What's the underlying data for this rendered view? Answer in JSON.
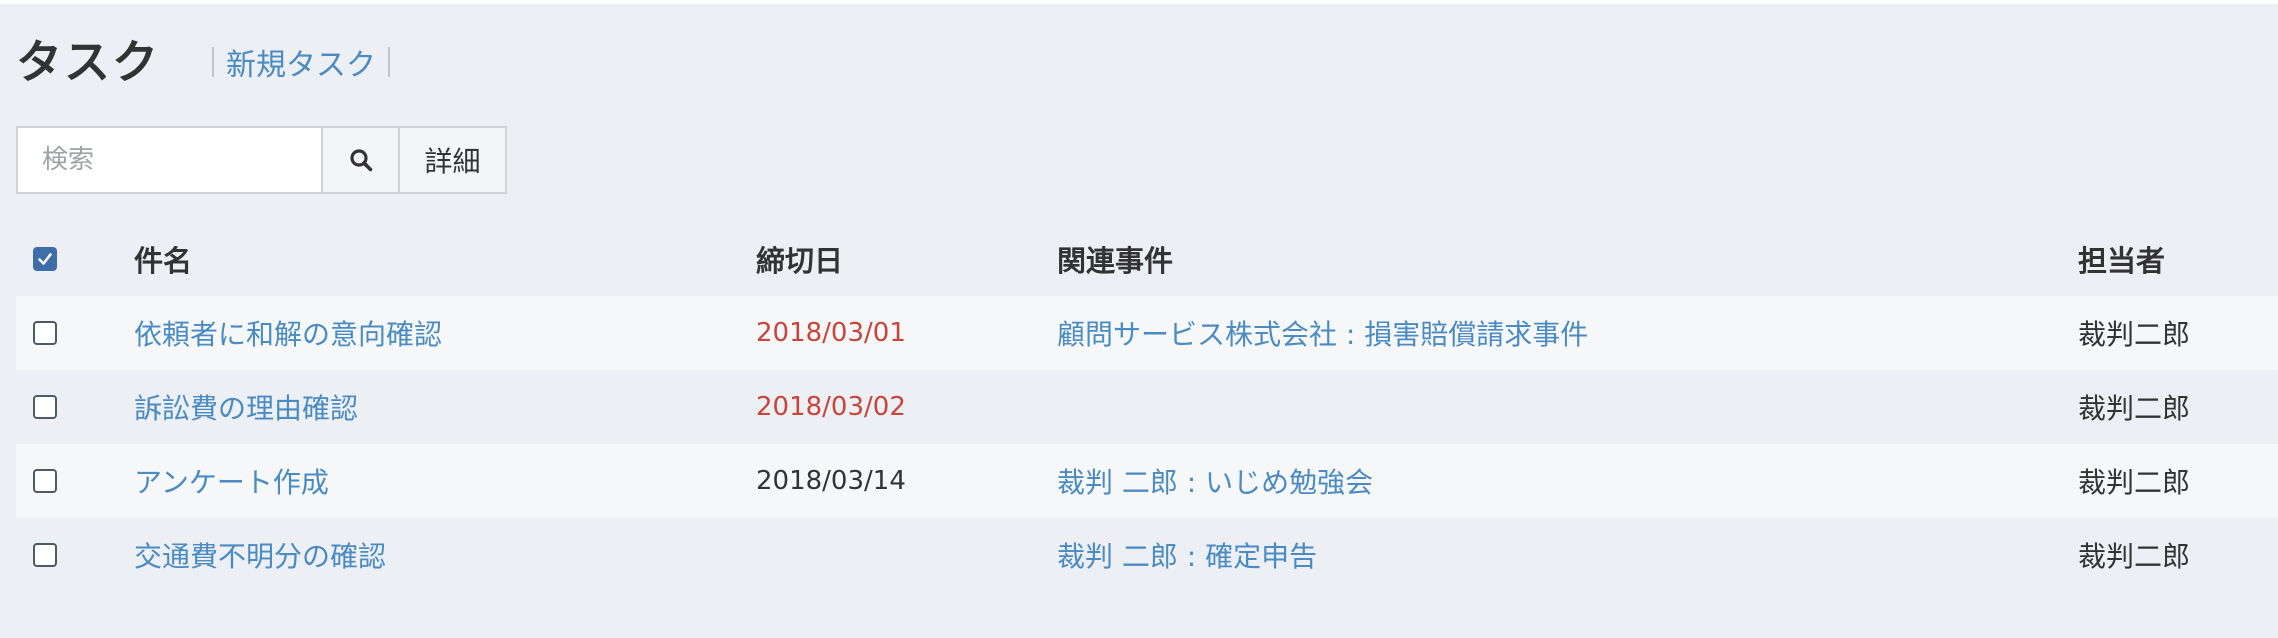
{
  "header": {
    "title": "タスク",
    "new_task_link": "新規タスク"
  },
  "search": {
    "placeholder": "検索",
    "search_icon": "search-icon",
    "detail_label": "詳細"
  },
  "table": {
    "select_all_checked": true,
    "columns": {
      "name": "件名",
      "due": "締切日",
      "matter": "関連事件",
      "owner": "担当者"
    },
    "rows": [
      {
        "name": "依頼者に和解の意向確認",
        "due": "2018/03/01",
        "due_overdue": true,
        "matter": "顧問サービス株式会社 : 損害賠償請求事件",
        "owner": "裁判二郎",
        "checked": false
      },
      {
        "name": "訴訟費の理由確認",
        "due": "2018/03/02",
        "due_overdue": true,
        "matter": "",
        "owner": "裁判二郎",
        "checked": false
      },
      {
        "name": "アンケート作成",
        "due": "2018/03/14",
        "due_overdue": false,
        "matter": "裁判 二郎 : いじめ勉強会",
        "owner": "裁判二郎",
        "checked": false
      },
      {
        "name": "交通費不明分の確認",
        "due": "",
        "due_overdue": false,
        "matter": "裁判 二郎 : 確定申告",
        "owner": "裁判二郎",
        "checked": false
      }
    ]
  },
  "colors": {
    "background": "#eceff4",
    "link": "#4a8bc2",
    "overdue": "#c8453a",
    "checkbox_checked": "#3e6ea9"
  }
}
